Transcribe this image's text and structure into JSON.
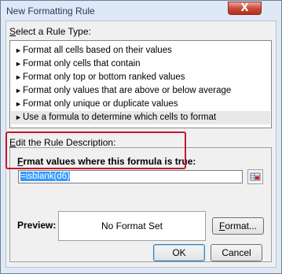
{
  "window": {
    "title": "New Formatting Rule",
    "close_label": "X"
  },
  "rule_type": {
    "label_prefix": "",
    "label_access": "S",
    "label_rest": "elect a Rule Type:",
    "items": [
      "Format all cells based on their values",
      "Format only cells that contain",
      "Format only top or bottom ranked values",
      "Format only values that are above or below average",
      "Format only unique or duplicate values",
      "Use a formula to determine which cells to format"
    ],
    "selected_index": 5
  },
  "description": {
    "label_prefix": "",
    "label_access": "E",
    "label_rest": "dit the Rule Description:",
    "formula_label_access": "O",
    "formula_label_rest": "rmat values where this formula is true:",
    "formula_label_prefix": "F",
    "formula_value": "=isblank(d6)"
  },
  "preview": {
    "label": "Preview:",
    "text": "No Format Set"
  },
  "buttons": {
    "format_access": "F",
    "format_rest": "ormat...",
    "ok": "OK",
    "cancel": "Cancel"
  }
}
